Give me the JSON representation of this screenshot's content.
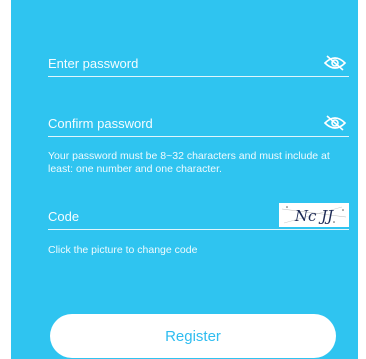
{
  "form": {
    "password": {
      "placeholder": "Enter password",
      "value": "",
      "icon": "eye-off-icon"
    },
    "confirm_password": {
      "placeholder": "Confirm password",
      "value": "",
      "icon": "eye-off-icon"
    },
    "password_hint": "Your password must be 8~32 characters and must include at least: one number and one character.",
    "code": {
      "placeholder": "Code",
      "value": "",
      "captcha_text": "Nc JJ"
    },
    "code_hint": "Click the picture to change code",
    "register_label": "Register"
  },
  "colors": {
    "background": "#2fc4f0",
    "button_text": "#2fbdf0",
    "text": "#ffffff"
  }
}
